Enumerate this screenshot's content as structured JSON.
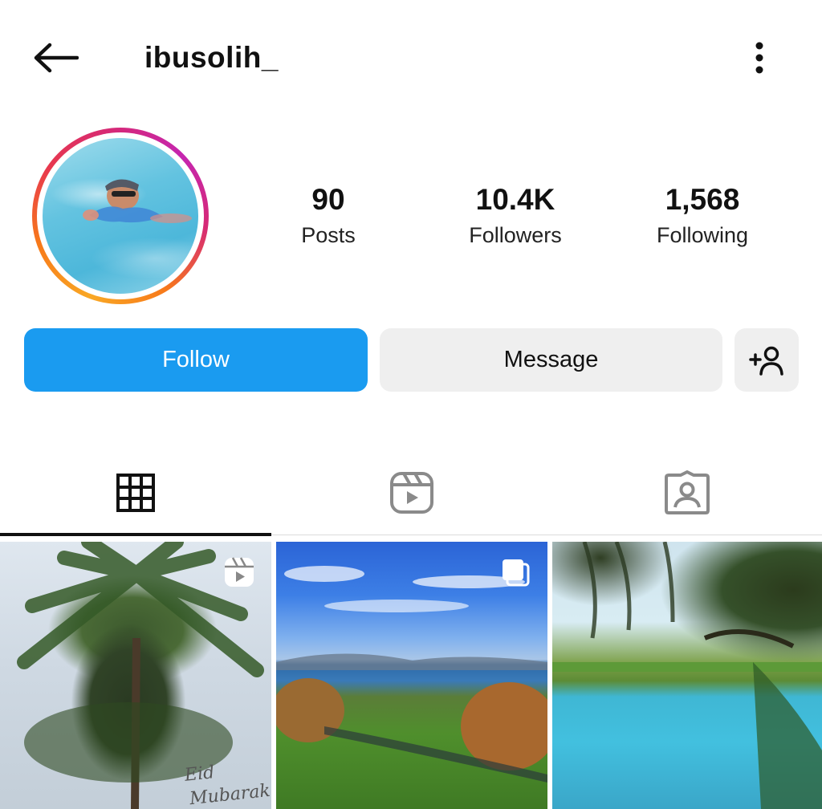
{
  "header": {
    "username": "ibusolih_",
    "back_icon": "arrow-left-icon",
    "more_icon": "more-vertical-icon"
  },
  "profile": {
    "avatar_ring_colors": [
      "#f9a825",
      "#e8394d",
      "#c526b0"
    ],
    "stats": [
      {
        "value": "90",
        "label": "Posts"
      },
      {
        "value": "10.4K",
        "label": "Followers"
      },
      {
        "value": "1,568",
        "label": "Following"
      }
    ]
  },
  "actions": {
    "follow_label": "Follow",
    "message_label": "Message",
    "add_icon": "add-person-icon",
    "follow_color": "#1a9bf0"
  },
  "tabs": [
    {
      "icon": "grid-icon",
      "active": true
    },
    {
      "icon": "reels-icon",
      "active": false
    },
    {
      "icon": "tagged-icon",
      "active": false
    }
  ],
  "posts": [
    {
      "caption_line1": "Eid",
      "caption_line2": "Mubarak",
      "badge_icon": "reels-icon"
    },
    {
      "badge_icon": "carousel-icon"
    },
    {}
  ]
}
